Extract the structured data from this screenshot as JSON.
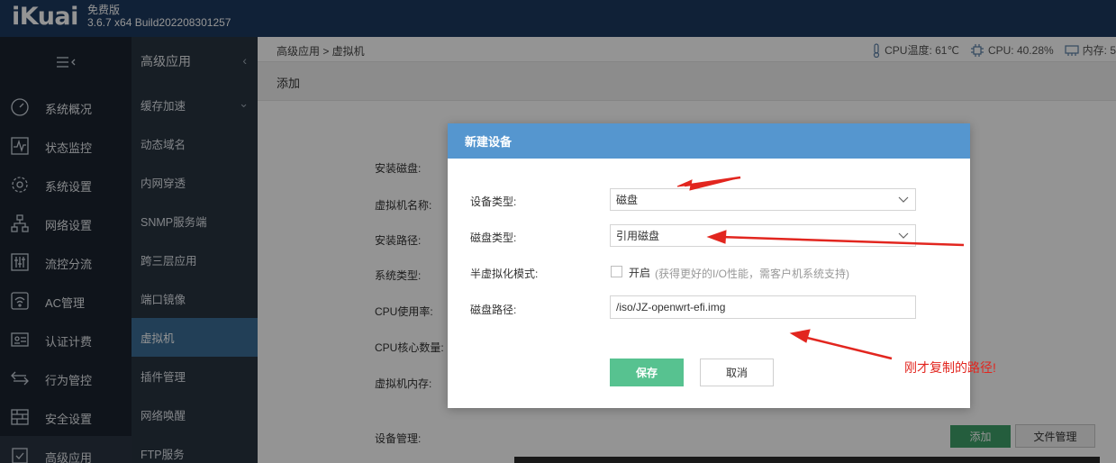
{
  "app": {
    "logo": "iKuai",
    "edition": "免费版",
    "version": "3.6.7 x64 Build202208301257"
  },
  "sidebar": {
    "toggle_icon": "collapse-menu-icon",
    "items": [
      {
        "label": "系统概况",
        "icon": "dashboard-icon"
      },
      {
        "label": "状态监控",
        "icon": "monitor-icon"
      },
      {
        "label": "系统设置",
        "icon": "gear-icon"
      },
      {
        "label": "网络设置",
        "icon": "network-icon"
      },
      {
        "label": "流控分流",
        "icon": "sliders-icon"
      },
      {
        "label": "AC管理",
        "icon": "wifi-icon"
      },
      {
        "label": "认证计费",
        "icon": "id-card-icon"
      },
      {
        "label": "行为管控",
        "icon": "swap-icon"
      },
      {
        "label": "安全设置",
        "icon": "firewall-icon"
      },
      {
        "label": "高级应用",
        "icon": "advanced-icon"
      }
    ]
  },
  "subnav": {
    "title": "高级应用",
    "items": [
      {
        "label": "缓存加速"
      },
      {
        "label": "动态域名"
      },
      {
        "label": "内网穿透"
      },
      {
        "label": "SNMP服务端"
      },
      {
        "label": "跨三层应用"
      },
      {
        "label": "端口镜像"
      },
      {
        "label": "虚拟机"
      },
      {
        "label": "插件管理"
      },
      {
        "label": "网络唤醒"
      },
      {
        "label": "FTP服务"
      }
    ]
  },
  "header": {
    "breadcrumb": "高级应用 > 虚拟机",
    "cpu_temp": "CPU温度: 61℃",
    "cpu_usage": "CPU: 40.28%",
    "memory": "内存: 5"
  },
  "toolbar": {
    "add": "添加"
  },
  "background_form": {
    "labels": [
      "安装磁盘:",
      "虚拟机名称:",
      "安装路径:",
      "系统类型:",
      "CPU使用率:",
      "CPU核心数量:",
      "虚拟机内存:"
    ],
    "device_mgmt_label": "设备管理:",
    "add_button": "添加",
    "file_mgmt_button": "文件管理"
  },
  "dialog": {
    "title": "新建设备",
    "device_type_label": "设备类型:",
    "device_type_value": "磁盘",
    "disk_type_label": "磁盘类型:",
    "disk_type_value": "引用磁盘",
    "paravirt_label": "半虚拟化模式:",
    "paravirt_checkbox_label": "开启",
    "paravirt_hint": "(获得更好的I/O性能，需客户机系统支持)",
    "disk_path_label": "磁盘路径:",
    "disk_path_value": "/iso/JZ-openwrt-efi.img",
    "save": "保存",
    "cancel": "取消"
  },
  "annotation": {
    "text": "刚才复制的路径!",
    "color": "#e2261f"
  },
  "colors": {
    "topbar": "#1d3a5f",
    "sidebar": "#1a2330",
    "subnav": "#293441",
    "subnav_active": "#3c6d97",
    "dialog_header": "#5596cf",
    "save_button": "#57c290"
  }
}
